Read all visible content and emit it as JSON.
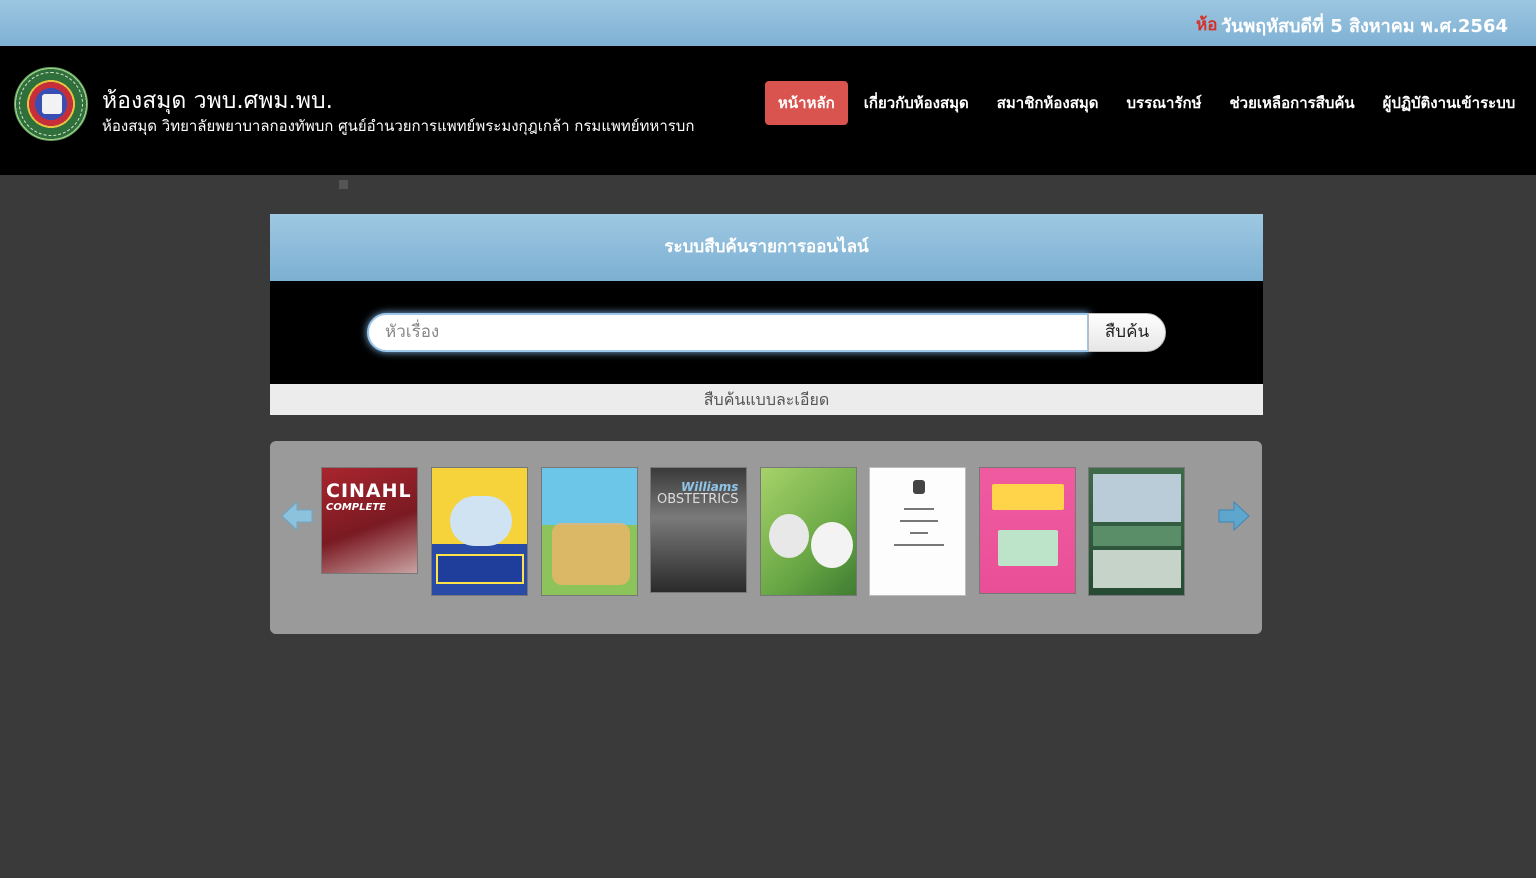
{
  "topbar": {
    "marquee_text": "ห้อ",
    "date_text": "วันพฤหัสบดีที่ 5 สิงหาคม พ.ศ.2564"
  },
  "header": {
    "title": "ห้องสมุด วพบ.ศพม.พบ.",
    "subtitle": "ห้องสมุด วิทยาลัยพยาบาลกองทัพบก ศูนย์อำนวยการแพทย์พระมงกุฎเกล้า กรมแพทย์ทหารบก"
  },
  "nav": {
    "items": [
      {
        "label": "หน้าหลัก",
        "active": true
      },
      {
        "label": "เกี่ยวกับห้องสมุด"
      },
      {
        "label": "สมาชิกห้องสมุด"
      },
      {
        "label": "บรรณารักษ์"
      },
      {
        "label": "ช่วยเหลือการสืบค้น"
      },
      {
        "label": "ผู้ปฏิบัติงานเข้าระบบ"
      }
    ]
  },
  "search": {
    "heading": "ระบบสืบค้นรายการออนไลน์",
    "placeholder": "หัวเรื่อง",
    "button": "สืบค้น",
    "advanced": "สืบค้นแบบละเอียด"
  },
  "carousel": {
    "books": [
      {
        "name": "book-cinahl",
        "text": "CINAHL",
        "text2": "COMPLETE"
      },
      {
        "name": "book-yellow-blue"
      },
      {
        "name": "book-children-cartoon"
      },
      {
        "name": "book-williams-obstetrics",
        "text": "Williams",
        "text2": "OBSTETRICS"
      },
      {
        "name": "book-green-brain"
      },
      {
        "name": "book-white-document"
      },
      {
        "name": "book-pink-hospital"
      },
      {
        "name": "book-nursing-photo"
      }
    ]
  }
}
